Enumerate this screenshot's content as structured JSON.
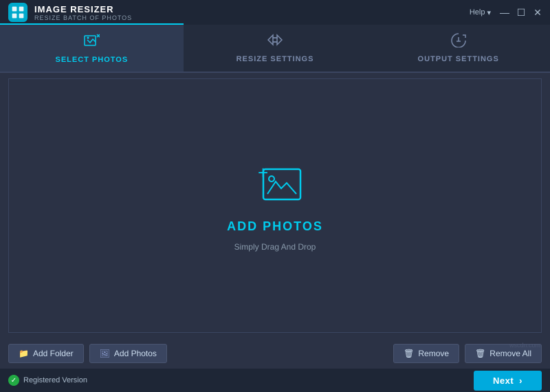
{
  "titleBar": {
    "appTitle": "IMAGE RESIZER",
    "appSubtitle": "RESIZE BATCH OF PHOTOS",
    "helpLabel": "Help",
    "minimizeSymbol": "—",
    "maximizeSymbol": "☐",
    "closeSymbol": "✕"
  },
  "tabs": [
    {
      "id": "select",
      "label": "SELECT PHOTOS",
      "active": true
    },
    {
      "id": "resize",
      "label": "RESIZE SETTINGS",
      "active": false
    },
    {
      "id": "output",
      "label": "OUTPUT SETTINGS",
      "active": false
    }
  ],
  "dropZone": {
    "addPhotosLabel": "ADD PHOTOS",
    "dragDropLabel": "Simply Drag And Drop"
  },
  "buttons": {
    "addFolder": "Add Folder",
    "addPhotos": "Add Photos",
    "remove": "Remove",
    "removeAll": "Remove All",
    "next": "Next"
  },
  "statusBar": {
    "registeredLabel": "Registered Version"
  },
  "watermark": "wscdn.com"
}
